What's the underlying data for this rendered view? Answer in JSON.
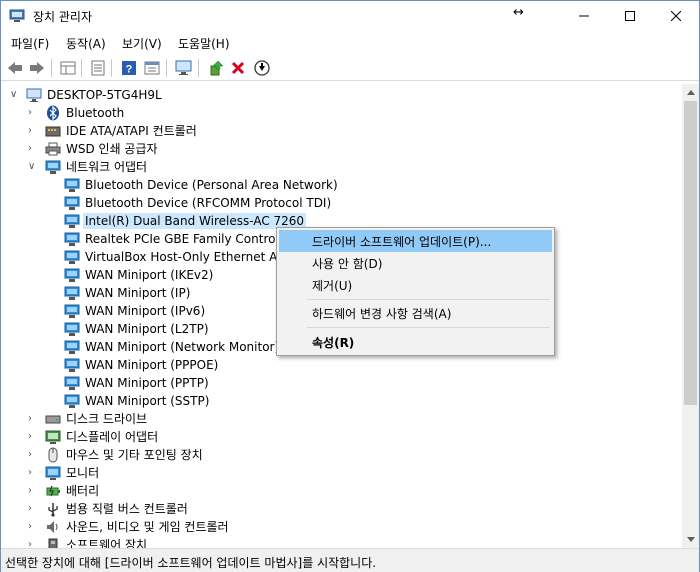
{
  "window": {
    "title": "장치 관리자",
    "resize_arrows": "↔"
  },
  "menu": [
    "파일(F)",
    "동작(A)",
    "보기(V)",
    "도움말(H)"
  ],
  "toolbar": {
    "buttons": [
      "back-icon",
      "forward-icon",
      "properties-grid-icon",
      "list-icon",
      "help-icon",
      "resource-icon",
      "monitor-scan-icon",
      "update-driver-icon",
      "uninstall-icon",
      "disable-icon"
    ]
  },
  "tree": {
    "root": "DESKTOP-5TG4H9L",
    "categories": [
      {
        "label": "Bluetooth",
        "icon": "bluetooth-icon"
      },
      {
        "label": "IDE ATA/ATAPI 컨트롤러",
        "icon": "ide-controller-icon"
      },
      {
        "label": "WSD 인쇄 공급자",
        "icon": "printer-icon"
      },
      {
        "label": "네트워크 어댑터",
        "icon": "network-adapter-icon",
        "expanded": true
      }
    ],
    "network_adapters": [
      "Bluetooth Device (Personal Area Network)",
      "Bluetooth Device (RFCOMM Protocol TDI)",
      "Intel(R) Dual Band Wireless-AC 7260",
      "Realtek PCIe GBE Family Controller",
      "VirtualBox Host-Only Ethernet Adap",
      "WAN Miniport (IKEv2)",
      "WAN Miniport (IP)",
      "WAN Miniport (IPv6)",
      "WAN Miniport (L2TP)",
      "WAN Miniport (Network Monitor)",
      "WAN Miniport (PPPOE)",
      "WAN Miniport (PPTP)",
      "WAN Miniport (SSTP)"
    ],
    "more_categories": [
      {
        "label": "디스크 드라이브",
        "icon": "disk-drive-icon"
      },
      {
        "label": "디스플레이 어댑터",
        "icon": "display-adapter-icon"
      },
      {
        "label": "마우스 및 기타 포인팅 장치",
        "icon": "mouse-icon"
      },
      {
        "label": "모니터",
        "icon": "monitor-icon"
      },
      {
        "label": "배터리",
        "icon": "battery-icon"
      },
      {
        "label": "범용 직렬 버스 컨트롤러",
        "icon": "usb-controller-icon"
      },
      {
        "label": "사운드, 비디오 및 게임 컨트롤러",
        "icon": "sound-icon"
      },
      {
        "label": "소프트웨어 장치",
        "icon": "software-device-icon"
      }
    ]
  },
  "context_menu": {
    "items": [
      {
        "label": "드라이버 소프트웨어 업데이트(P)...",
        "highlighted": true
      },
      {
        "label": "사용 안 함(D)"
      },
      {
        "label": "제거(U)"
      },
      {
        "label": "하드웨어 변경 사항 검색(A)"
      },
      {
        "label": "속성(R)",
        "bold": true
      }
    ]
  },
  "status": "선택한 장치에 대해 [드라이버 소프트웨어 업데이트 마법사]를 시작합니다.",
  "colors": {
    "selection": "#cce8ff",
    "menu_highlight": "#91c9f7",
    "network_icon": "#2f8fd8",
    "uninstall_red": "#d9001b"
  }
}
